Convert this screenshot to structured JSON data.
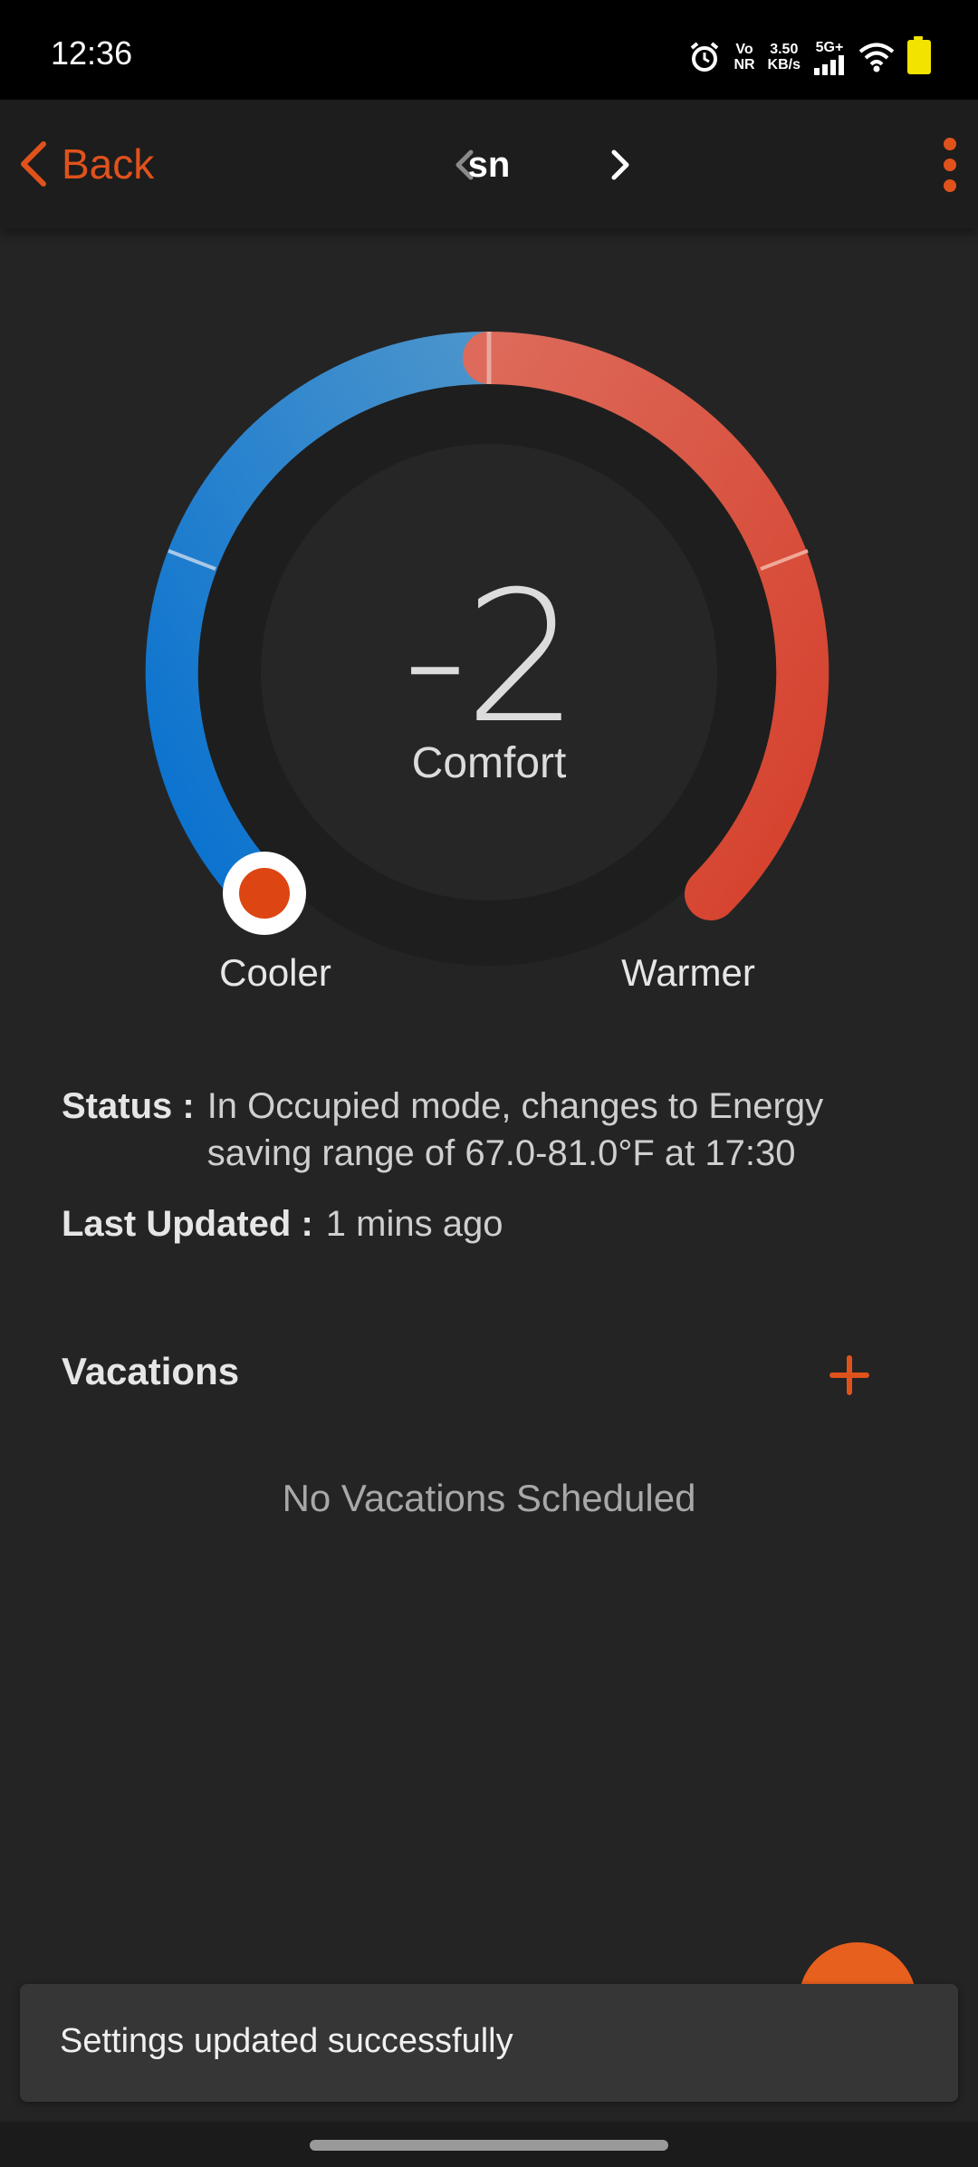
{
  "status_bar": {
    "time": "12:36",
    "volte": "Vo\nNR",
    "speed": "3.50\nKB/s",
    "network": "5G+"
  },
  "app_bar": {
    "back_label": "Back",
    "title": "sn"
  },
  "dial": {
    "value": "-2",
    "mode": "Comfort",
    "cooler_label": "Cooler",
    "warmer_label": "Warmer"
  },
  "info": {
    "status_key": "Status :",
    "status_value": "In Occupied mode, changes to Energy saving range of 67.0-81.0°F at 17:30",
    "updated_key": "Last Updated :",
    "updated_value": "1 mins ago"
  },
  "vacations": {
    "title": "Vacations",
    "empty_text": "No Vacations Scheduled"
  },
  "snackbar": {
    "message": "Settings updated successfully"
  },
  "colors": {
    "accent": "#e0521c",
    "cool": "#0a74d2",
    "warm": "#d9402c",
    "background": "#242424"
  }
}
